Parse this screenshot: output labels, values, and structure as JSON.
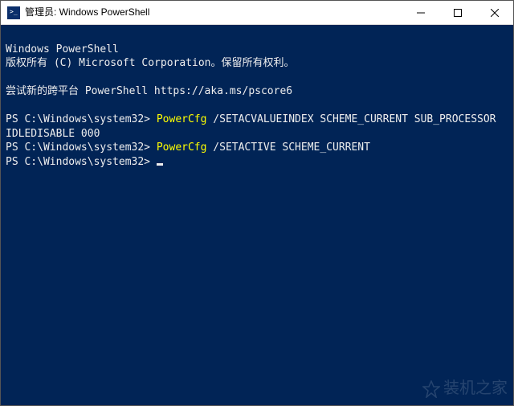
{
  "titlebar": {
    "title": "管理员: Windows PowerShell"
  },
  "terminal": {
    "header1": "Windows PowerShell",
    "header2": "版权所有 (C) Microsoft Corporation。保留所有权利。",
    "motd": "尝试新的跨平台 PowerShell https://aka.ms/pscore6",
    "prompt": "PS C:\\Windows\\system32> ",
    "lines": [
      {
        "cmd": "PowerCfg",
        "args": " /SETACVALUEINDEX SCHEME_CURRENT SUB_PROCESSOR IDLEDISABLE 000"
      },
      {
        "cmd": "PowerCfg",
        "args": " /SETACTIVE SCHEME_CURRENT"
      }
    ]
  },
  "watermark": "装机之家"
}
